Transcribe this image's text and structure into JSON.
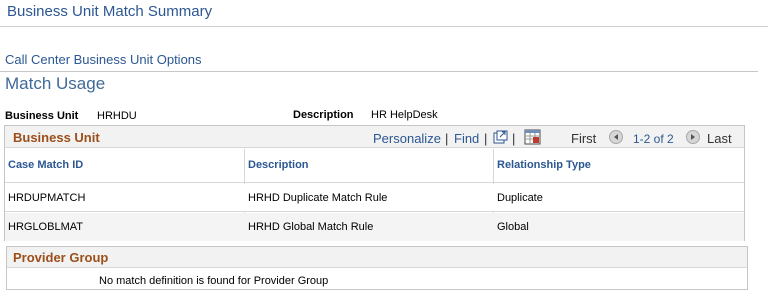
{
  "page": {
    "title": "Business Unit Match Summary"
  },
  "subpage": {
    "link": "Call Center Business Unit Options"
  },
  "section": {
    "title": "Match Usage"
  },
  "fields": {
    "business_unit_label": "Business Unit",
    "business_unit_value": "HRHDU",
    "description_label": "Description",
    "description_value": "HR HelpDesk"
  },
  "grid": {
    "title": "Business Unit",
    "personalize": "Personalize",
    "find": "Find",
    "sep": "|",
    "first": "First",
    "count": "1-2 of 2",
    "last": "Last",
    "columns": [
      "Case Match ID",
      "Description",
      "Relationship Type"
    ],
    "rows": [
      [
        "HRDUPMATCH",
        "HRHD Duplicate Match Rule",
        "Duplicate"
      ],
      [
        "HRGLOBLMAT",
        "HRHD Global Match Rule",
        "Global"
      ]
    ]
  },
  "provider_group": {
    "title": "Provider Group",
    "message": "No match definition is found for Provider Group"
  },
  "icons": {
    "view_all": "view-all-icon",
    "download": "download-to-excel-icon",
    "prev": "previous-arrow-icon",
    "next": "next-arrow-icon"
  },
  "colors": {
    "link_blue": "#2c5792",
    "grid_title": "#9c4f1a",
    "header_bg": "#f2f2f2"
  }
}
